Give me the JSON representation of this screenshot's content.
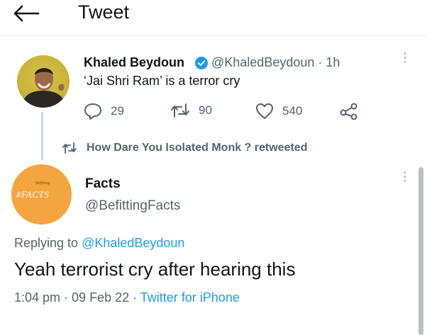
{
  "header": {
    "title": "Tweet"
  },
  "tweet1": {
    "name": "Khaled Beydoun",
    "handle_time": "@KhaledBeydoun · 1h",
    "text": "‘Jai Shri Ram’ is a terror cry",
    "replies": "29",
    "retweets": "90",
    "likes": "540"
  },
  "retweet_notice": {
    "text": "How Dare You Isolated Monk ? retweeted"
  },
  "tweet2": {
    "name": "Facts",
    "handle": "@BefittingFacts",
    "avatar_small_text": "Befitting",
    "avatar_big_text": "#FACTS",
    "replying_prefix": "Replying to ",
    "replying_to": "@KhaledBeydoun",
    "text": "Yeah terrorist cry after hearing this",
    "time": "1:04 pm",
    "sep1": " · ",
    "date": "09 Feb 22",
    "sep2": " · ",
    "source": "Twitter for iPhone"
  },
  "colors": {
    "accent": "#1d9bf0",
    "verified": "#1d9bf0",
    "muted": "#536471",
    "avatar2_bg": "#f4a540"
  },
  "icons": [
    "back-arrow-icon",
    "verified-icon",
    "more-icon",
    "reply-icon",
    "retweet-icon",
    "like-icon",
    "share-icon"
  ]
}
